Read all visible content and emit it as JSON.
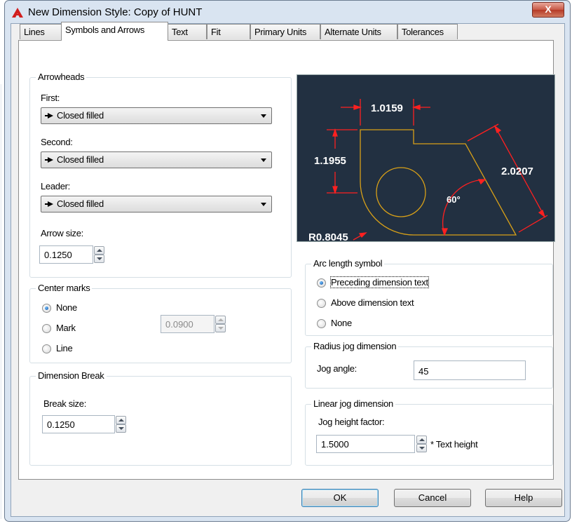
{
  "window": {
    "title": "New Dimension Style: Copy of HUNT",
    "close_label": "X"
  },
  "tabs": [
    {
      "label": "Lines",
      "active": false
    },
    {
      "label": "Symbols and Arrows",
      "active": true
    },
    {
      "label": "Text",
      "active": false
    },
    {
      "label": "Fit",
      "active": false
    },
    {
      "label": "Primary Units",
      "active": false
    },
    {
      "label": "Alternate Units",
      "active": false
    },
    {
      "label": "Tolerances",
      "active": false
    }
  ],
  "arrowheads": {
    "title": "Arrowheads",
    "first_label": "First:",
    "first_value": "Closed filled",
    "second_label": "Second:",
    "second_value": "Closed filled",
    "leader_label": "Leader:",
    "leader_value": "Closed filled",
    "arrow_size_label": "Arrow size:",
    "arrow_size_value": "0.1250"
  },
  "center_marks": {
    "title": "Center marks",
    "options": [
      "None",
      "Mark",
      "Line"
    ],
    "selected": "None",
    "size_value": "0.0900"
  },
  "dimension_break": {
    "title": "Dimension Break",
    "break_size_label": "Break size:",
    "break_size_value": "0.1250"
  },
  "preview": {
    "dim_top": "1.0159",
    "dim_left": "1.1955",
    "dim_right": "2.0207",
    "angle": "60°",
    "radius": "R0.8045",
    "colors": {
      "background": "#223041",
      "dimension": "#ff2020",
      "geometry": "#d8a018",
      "text": "#ffffff"
    }
  },
  "arc_length_symbol": {
    "title": "Arc length symbol",
    "options": [
      "Preceding dimension text",
      "Above dimension text",
      "None"
    ],
    "selected": "Preceding dimension text"
  },
  "radius_jog": {
    "title": "Radius jog dimension",
    "jog_angle_label": "Jog angle:",
    "jog_angle_value": "45"
  },
  "linear_jog": {
    "title": "Linear jog dimension",
    "height_factor_label": "Jog height factor:",
    "height_factor_value": "1.5000",
    "suffix": "* Text height"
  },
  "buttons": {
    "ok": "OK",
    "cancel": "Cancel",
    "help": "Help"
  },
  "icons": [
    "autocad-logo-icon",
    "close-icon",
    "arrowhead-icon",
    "dropdown-arrow-icon",
    "spin-up-icon",
    "spin-down-icon"
  ]
}
